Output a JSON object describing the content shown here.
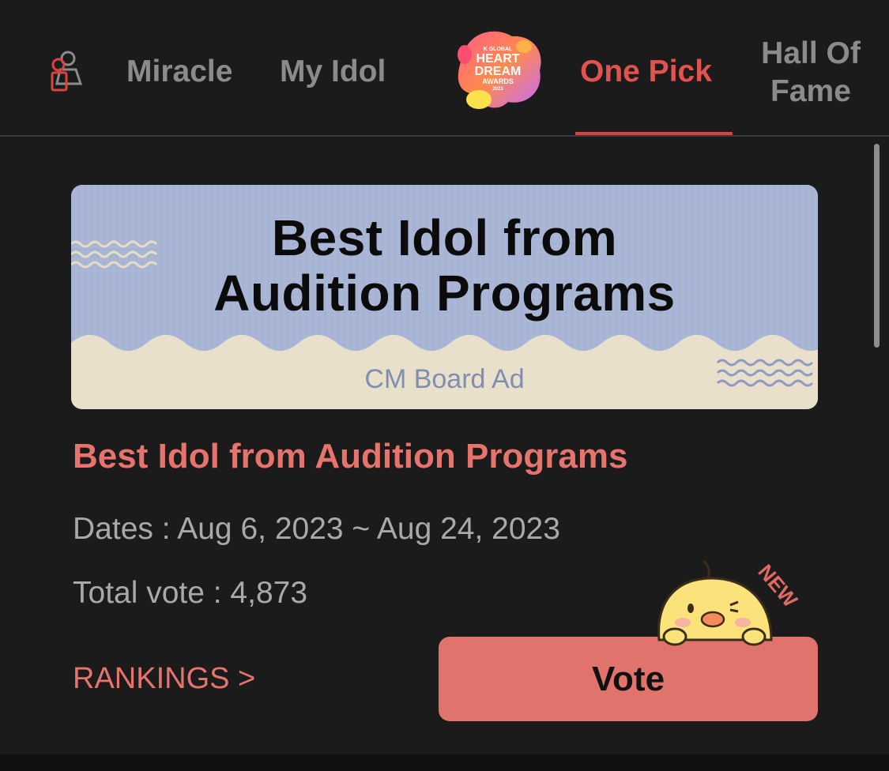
{
  "nav": {
    "tabs": [
      {
        "label": "Miracle"
      },
      {
        "label": "My Idol"
      },
      {
        "label": "One Pick"
      },
      {
        "label_line1": "Hall Of",
        "label_line2": "Fame"
      }
    ],
    "logo_text": {
      "line1": "K GLOBAL",
      "line2": "HEART",
      "line3": "DREAM",
      "line4": "AWARDS",
      "line5": "2023"
    },
    "active_tab": "One Pick"
  },
  "banner": {
    "title_line1": "Best Idol from",
    "title_line2": "Audition Programs",
    "ad_label": "CM Board Ad"
  },
  "vote": {
    "title": "Best Idol from Audition Programs",
    "dates": "Dates : Aug 6, 2023 ~ Aug 24, 2023",
    "total": "Total vote : 4,873",
    "rankings_label": "RANKINGS >",
    "vote_label": "Vote",
    "new_badge": "NEW"
  },
  "colors": {
    "accent": "#e0534e",
    "accent_soft": "#e6736c",
    "background": "#1b1b1b",
    "banner_blue": "#a7b3d3",
    "banner_cream": "#e9e0cc"
  }
}
